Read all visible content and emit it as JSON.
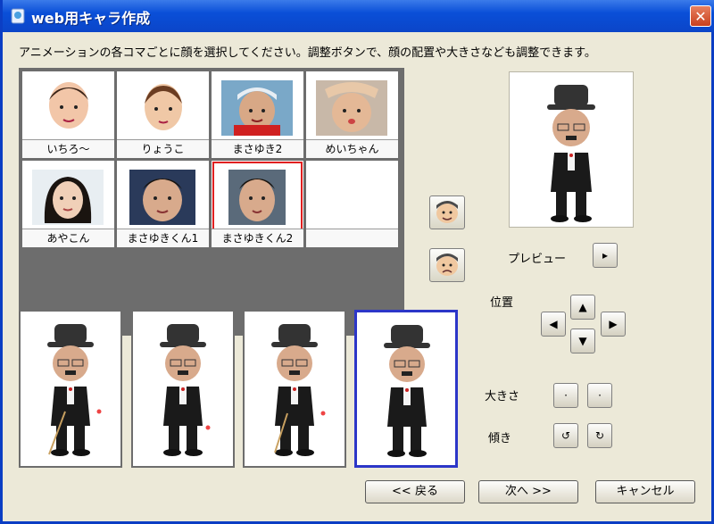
{
  "window": {
    "title": "web用キャラ作成",
    "close_glyph": "✕"
  },
  "instruction": "アニメーションの各コマごとに顔を選択してください。調整ボタンで、顔の配置や大きさなども調整できます。",
  "faces": [
    {
      "label": "いちろ～"
    },
    {
      "label": "りょうこ"
    },
    {
      "label": "まさゆき2"
    },
    {
      "label": "めいちゃん"
    },
    {
      "label": "あやこん"
    },
    {
      "label": "まさゆきくん1"
    },
    {
      "label": "まさゆきくん2",
      "selected": true
    },
    {
      "label": ""
    }
  ],
  "preview": {
    "label": "プレビュー",
    "play_glyph": "▸"
  },
  "position": {
    "label": "位置",
    "up": "▲",
    "down": "▼",
    "left": "◀",
    "right": "▶"
  },
  "size": {
    "label": "大きさ",
    "shrink": "·",
    "enlarge": "·"
  },
  "tilt": {
    "label": "傾き",
    "ccw": "↺",
    "cw": "↻"
  },
  "buttons": {
    "back": "<< 戻る",
    "next": "次へ >>",
    "cancel": "キャンセル"
  },
  "colors": {
    "title_bar": "#0a4fd8",
    "window_bg": "#ece9d8",
    "selected_face": "#e02020",
    "active_frame": "#2c36c8"
  }
}
